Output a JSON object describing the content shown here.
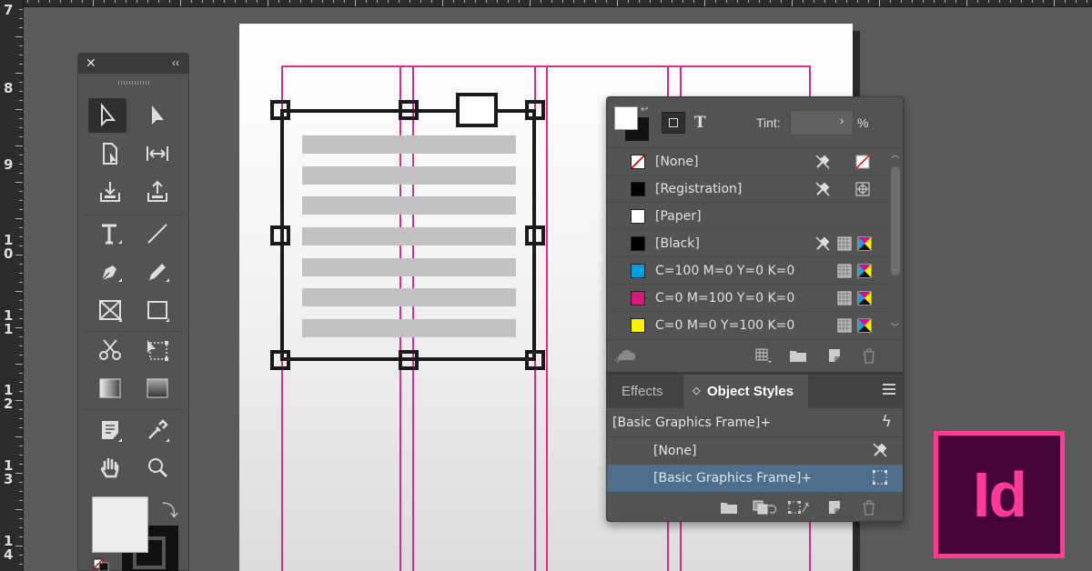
{
  "ruler": {
    "numbers": [
      "7",
      "8",
      "9",
      "1\n0",
      "1\n1",
      "1\n2",
      "1\n3",
      "1\n4"
    ]
  },
  "toolbox": {
    "close_glyph": "✕",
    "collapse_glyph": "‹‹",
    "swap_glyph": "⤵"
  },
  "swatches_panel": {
    "tint_label": "Tint:",
    "tint_value": "",
    "tint_percent": "%",
    "text_format_glyph": "T",
    "swatches": [
      {
        "name": "[None]",
        "color": "none"
      },
      {
        "name": "[Registration]",
        "color": "#000000"
      },
      {
        "name": "[Paper]",
        "color": "#ffffff"
      },
      {
        "name": "[Black]",
        "color": "#000000"
      },
      {
        "name": "C=100 M=0 Y=0 K=0",
        "color": "#00a0e3"
      },
      {
        "name": "C=0 M=100 Y=0 K=0",
        "color": "#d6197b"
      },
      {
        "name": "C=0 M=0 Y=100 K=0",
        "color": "#fff200"
      }
    ]
  },
  "object_styles_panel": {
    "tabs": {
      "effects": "Effects",
      "object_styles": "Object Styles"
    },
    "current_style": "[Basic Graphics Frame]+",
    "styles": [
      {
        "name": "[None]"
      },
      {
        "name": "[Basic Graphics Frame]+"
      }
    ]
  },
  "app_logo": {
    "text": "Id",
    "color": "#ff3a98"
  }
}
